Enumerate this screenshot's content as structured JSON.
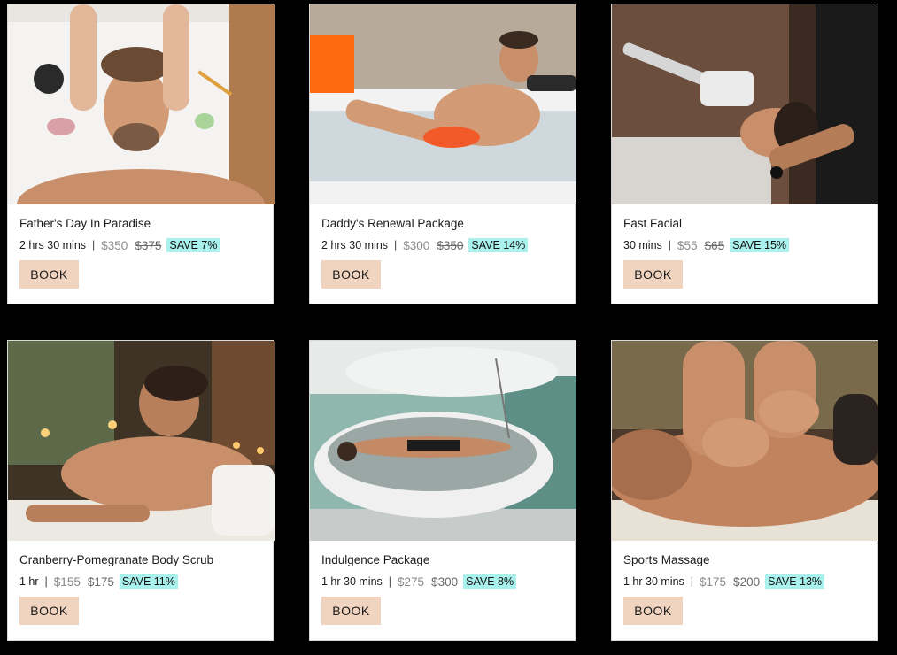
{
  "packages": [
    {
      "title": "Father's Day In Paradise",
      "duration": "2 hrs 30 mins",
      "price": "$350",
      "original_price": "$375",
      "save": "SAVE 7%",
      "book_label": "BOOK"
    },
    {
      "title": "Daddy's Renewal Package",
      "duration": "2 hrs 30 mins",
      "price": "$300",
      "original_price": "$350",
      "save": "SAVE 14%",
      "book_label": "BOOK"
    },
    {
      "title": "Fast Facial",
      "duration": "30 mins",
      "price": "$55",
      "original_price": "$65",
      "save": "SAVE 15%",
      "book_label": "BOOK"
    },
    {
      "title": "Cranberry-Pomegranate Body Scrub",
      "duration": "1 hr",
      "price": "$155",
      "original_price": "$175",
      "save": "SAVE 11%",
      "book_label": "BOOK"
    },
    {
      "title": "Indulgence Package",
      "duration": "1 hr 30 mins",
      "price": "$275",
      "original_price": "$300",
      "save": "SAVE 8%",
      "book_label": "BOOK"
    },
    {
      "title": "Sports Massage",
      "duration": "1 hr 30 mins",
      "price": "$175",
      "original_price": "$200",
      "save": "SAVE 13%",
      "book_label": "BOOK"
    }
  ],
  "colors": {
    "page_background": "#000000",
    "card_background": "#ffffff",
    "book_button": "#f1d4bf",
    "save_badge": "#a9f1ec"
  }
}
